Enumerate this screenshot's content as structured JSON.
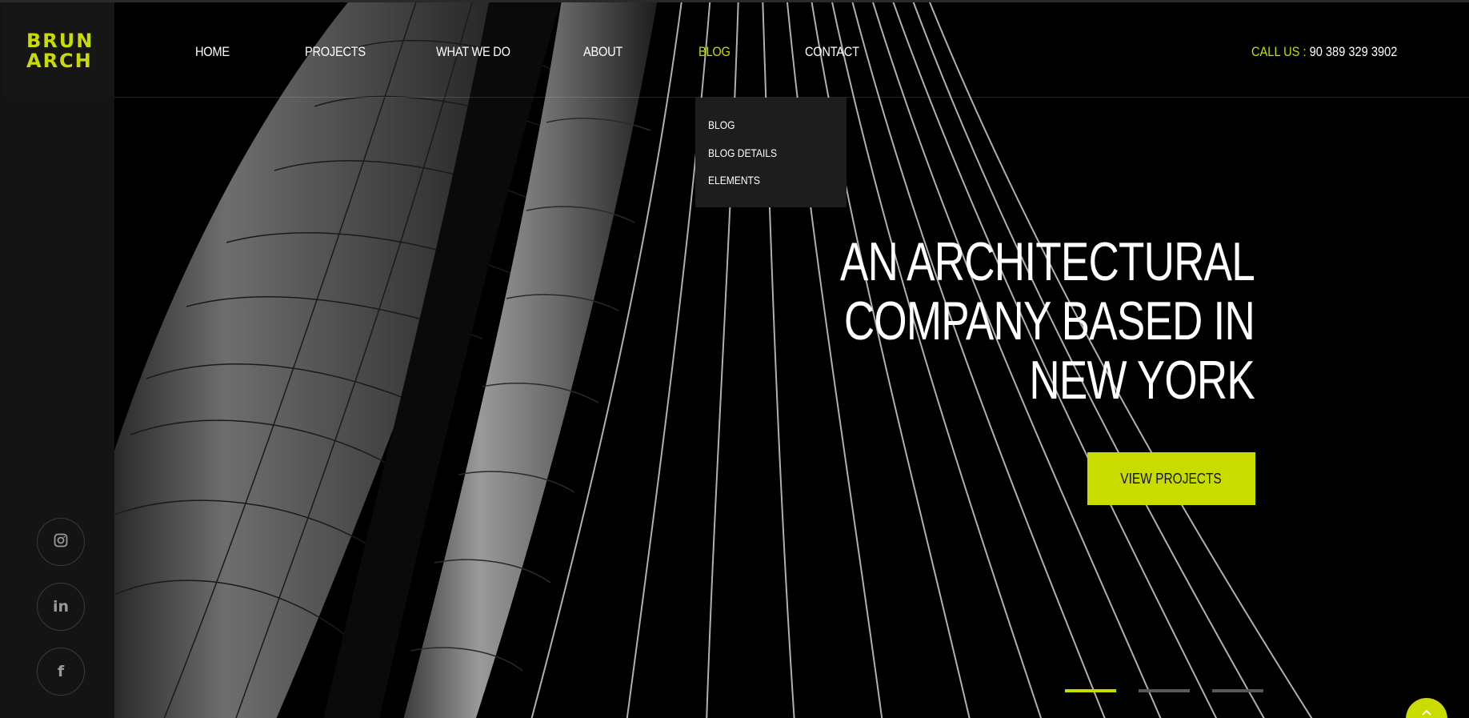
{
  "logo": {
    "line1": "BRUN",
    "line2": "ARCH",
    "color": "#c9dc00"
  },
  "nav": {
    "items": [
      {
        "label": "HOME"
      },
      {
        "label": "PROJECTS"
      },
      {
        "label": "WHAT WE DO"
      },
      {
        "label": "ABOUT"
      },
      {
        "label": "BLOG",
        "active": true
      },
      {
        "label": "CONTACT"
      }
    ],
    "call_label": "CALL US :",
    "call_number": "90 389 329 3902"
  },
  "dropdown": {
    "items": [
      {
        "label": "BLOG"
      },
      {
        "label": "BLOG DETAILS"
      },
      {
        "label": "ELEMENTS"
      }
    ]
  },
  "hero": {
    "headline_lines": [
      "AN ARCHITECTURAL",
      "COMPANY BASED IN",
      "NEW YORK"
    ],
    "cta_label": "VIEW PROJECTS",
    "slides": {
      "count": 3,
      "active_index": 0
    }
  },
  "social": [
    {
      "icon": "instagram-icon"
    },
    {
      "icon": "linkedin-icon",
      "glyph": "in"
    },
    {
      "icon": "facebook-icon",
      "glyph": "f"
    }
  ],
  "colors": {
    "accent": "#c9dc00",
    "background": "#000000",
    "sidebar": "#141414",
    "dropdown": "#1d1d1d"
  }
}
